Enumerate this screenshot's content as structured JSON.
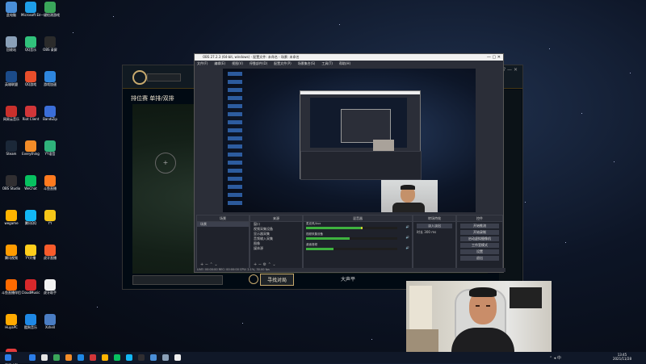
{
  "desktop": {
    "icons": [
      {
        "label": "此电脑",
        "color": "#4a8fd8"
      },
      {
        "label": "Microsoft Edge",
        "color": "#1e9ee8"
      },
      {
        "label": "一键检测游戏",
        "color": "#3aa65a"
      },
      {
        "label": "回收站",
        "color": "#8aa0b8"
      },
      {
        "label": "QQ音乐",
        "color": "#31c27c"
      },
      {
        "label": "OBS 录屏",
        "color": "#2b2b2b"
      },
      {
        "label": "英雄联盟",
        "color": "#1b4b8a"
      },
      {
        "label": "QQ游戏",
        "color": "#e84e2b"
      },
      {
        "label": "游戏加速",
        "color": "#2e86de"
      },
      {
        "label": "网易云音乐",
        "color": "#c9302c"
      },
      {
        "label": "Riot Client",
        "color": "#d13639"
      },
      {
        "label": "BandiZip",
        "color": "#3b6ed8"
      },
      {
        "label": "Steam",
        "color": "#1b2838"
      },
      {
        "label": "Everything",
        "color": "#f28c28"
      },
      {
        "label": "YY语音",
        "color": "#2fb37b"
      },
      {
        "label": "OBS Studio",
        "color": "#302e31"
      },
      {
        "label": "WeChat",
        "color": "#07c160"
      },
      {
        "label": "斗鱼直播",
        "color": "#ff7a1f"
      },
      {
        "label": "wegame",
        "color": "#ffb400"
      },
      {
        "label": "腾讯QQ",
        "color": "#12b7f5"
      },
      {
        "label": "YY",
        "color": "#f5c518"
      },
      {
        "label": "腾讯视频",
        "color": "#ff9c00"
      },
      {
        "label": "YY开播",
        "color": "#ffce1c"
      },
      {
        "label": "虎牙直播",
        "color": "#f85b2b"
      },
      {
        "label": "斗鱼直播伴侣",
        "color": "#ff6a00"
      },
      {
        "label": "CloudMusic",
        "color": "#d8282b"
      },
      {
        "label": "虎牙助手",
        "color": "#f2f2f2"
      },
      {
        "label": "HuyaPC",
        "color": "#ffaa00"
      },
      {
        "label": "酷狗音乐",
        "color": "#1e88e5"
      },
      {
        "label": "Xshell",
        "color": "#4a7dc3"
      },
      {
        "label": "金山毒霸",
        "color": "#e23b3b"
      }
    ]
  },
  "lol_client": {
    "mode_text": "排位赛 单排/双排",
    "find_match_label": "寻找对局",
    "peek_label": "大声平",
    "winctl": "? — ✕"
  },
  "obs": {
    "title": "OBS 27.2.3 (64-bit, windows) - 配置文件: 未命名 - 场景: 未命名",
    "menu": [
      "文件(F)",
      "编辑(E)",
      "视图(V)",
      "停靠部件(D)",
      "配置文件(P)",
      "场景集合(S)",
      "工具(T)",
      "帮助(H)"
    ],
    "docks": {
      "scenes": {
        "header": "场景",
        "items": [
          "场景"
        ]
      },
      "sources": {
        "header": "来源",
        "items": [
          "窗口",
          "视频采集设备",
          "显示器采集",
          "音频输入采集",
          "图像",
          "媒体源"
        ]
      },
      "mixer": {
        "header": "混音器",
        "rows": [
          {
            "name": "麦克风/Aux",
            "level": 0.62
          },
          {
            "name": "视频采集设备",
            "level": 0.48
          },
          {
            "name": "桌面音频",
            "level": 0.3
          }
        ]
      },
      "transitions": {
        "header": "转场特效",
        "type": "淡入淡出",
        "duration_label": "时长",
        "duration": "300 ms"
      },
      "controls": {
        "header": "控件",
        "buttons": [
          "开始推流",
          "开始录制",
          "启动虚拟摄像机",
          "工作室模式",
          "设置",
          "退出"
        ]
      }
    },
    "status_text": "LIVE: 00:00:00  REC: 00:00:00  CPU: 2.1%, 30.00 fps"
  },
  "taskbar": {
    "time": "13:45",
    "date": "2021/11/28",
    "tray": "⌃ ◂ 中",
    "apps": [
      "#2b7de9",
      "#e5e5e5",
      "#3aa65a",
      "#f28c28",
      "#1e88e5",
      "#d13639",
      "#ffb400",
      "#07c160",
      "#12b7f5",
      "#302e31",
      "#4a8fd8",
      "#8aa0b8",
      "#eeeeee"
    ]
  }
}
